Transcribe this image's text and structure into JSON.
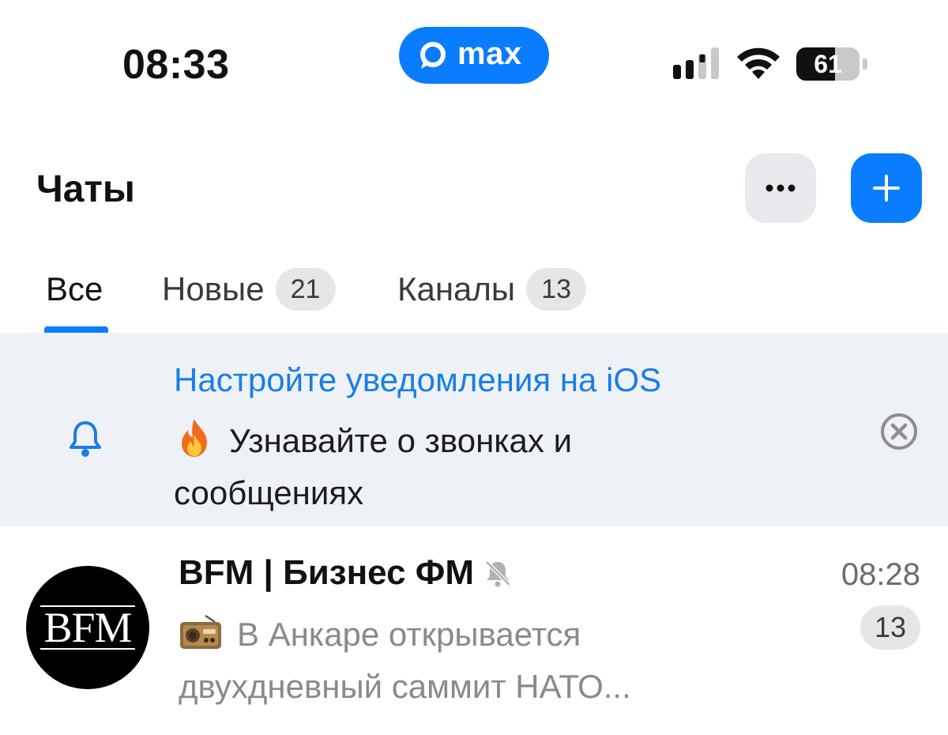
{
  "status_bar": {
    "time": "08:33",
    "app_pill": "max",
    "battery_percent": "61",
    "battery_level": 0.61,
    "signal_icon": "cellular-signal-icon",
    "wifi_icon": "wifi-icon"
  },
  "header": {
    "title": "Чаты",
    "more_icon": "ellipsis-icon",
    "add_icon": "plus-icon"
  },
  "tabs": [
    {
      "label": "Все",
      "badge": "",
      "active": true
    },
    {
      "label": "Новые",
      "badge": "21",
      "active": false
    },
    {
      "label": "Каналы",
      "badge": "13",
      "active": false
    }
  ],
  "notification_banner": {
    "title": "Настройте уведомления на iOS",
    "text": "Узнавайте о звонках и сообщениях",
    "icon": "bell-icon",
    "emoji_icon": "fire-emoji-icon",
    "close_icon": "close-circle-icon"
  },
  "chats": [
    {
      "avatar_text": "BFM",
      "name": "BFM | Бизнес ФМ",
      "muted": true,
      "time": "08:28",
      "unread": "13",
      "preview_emoji": "radio-emoji-icon",
      "preview": "В Анкаре открывается двухдневный саммит НАТО..."
    }
  ],
  "colors": {
    "accent": "#0a7cff",
    "banner_bg": "#eef2f7",
    "banner_title": "#1a7de8",
    "secondary_text": "#8a8a8e",
    "badge_bg": "#e6e6e9"
  }
}
